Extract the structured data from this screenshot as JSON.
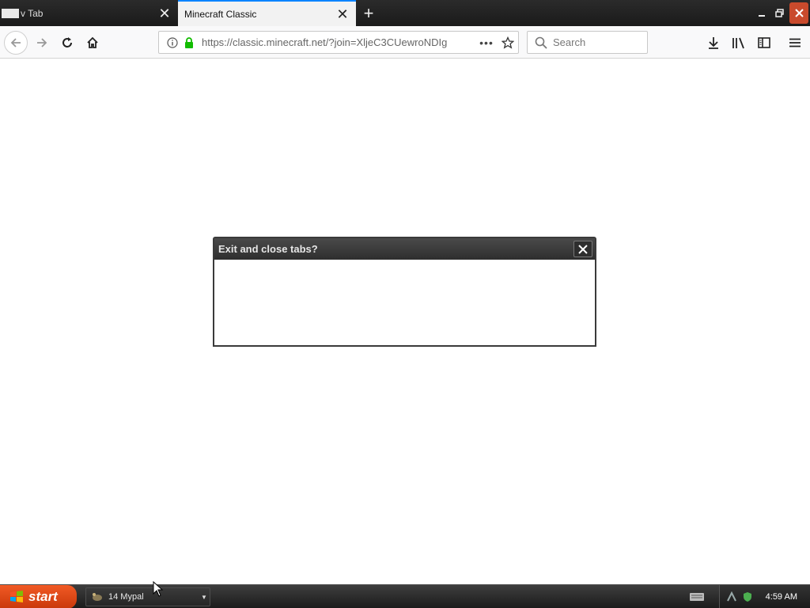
{
  "browser": {
    "tabs": [
      {
        "title": "v Tab",
        "active": false
      },
      {
        "title": "Minecraft Classic",
        "active": true
      }
    ],
    "url": "https://classic.minecraft.net/?join=XljeC3CUewroNDIg",
    "search_placeholder": "Search"
  },
  "dialog": {
    "title": "Exit and close tabs?"
  },
  "taskbar": {
    "start_label": "start",
    "task_item_label": "14 Mypal",
    "clock": "4:59 AM"
  },
  "colors": {
    "tab_strip": "#1f1f1f",
    "active_tab_accent": "#0a84ff",
    "lock_green": "#12bc00",
    "start_button": "#e0481a",
    "window_close": "#c94a2c"
  }
}
